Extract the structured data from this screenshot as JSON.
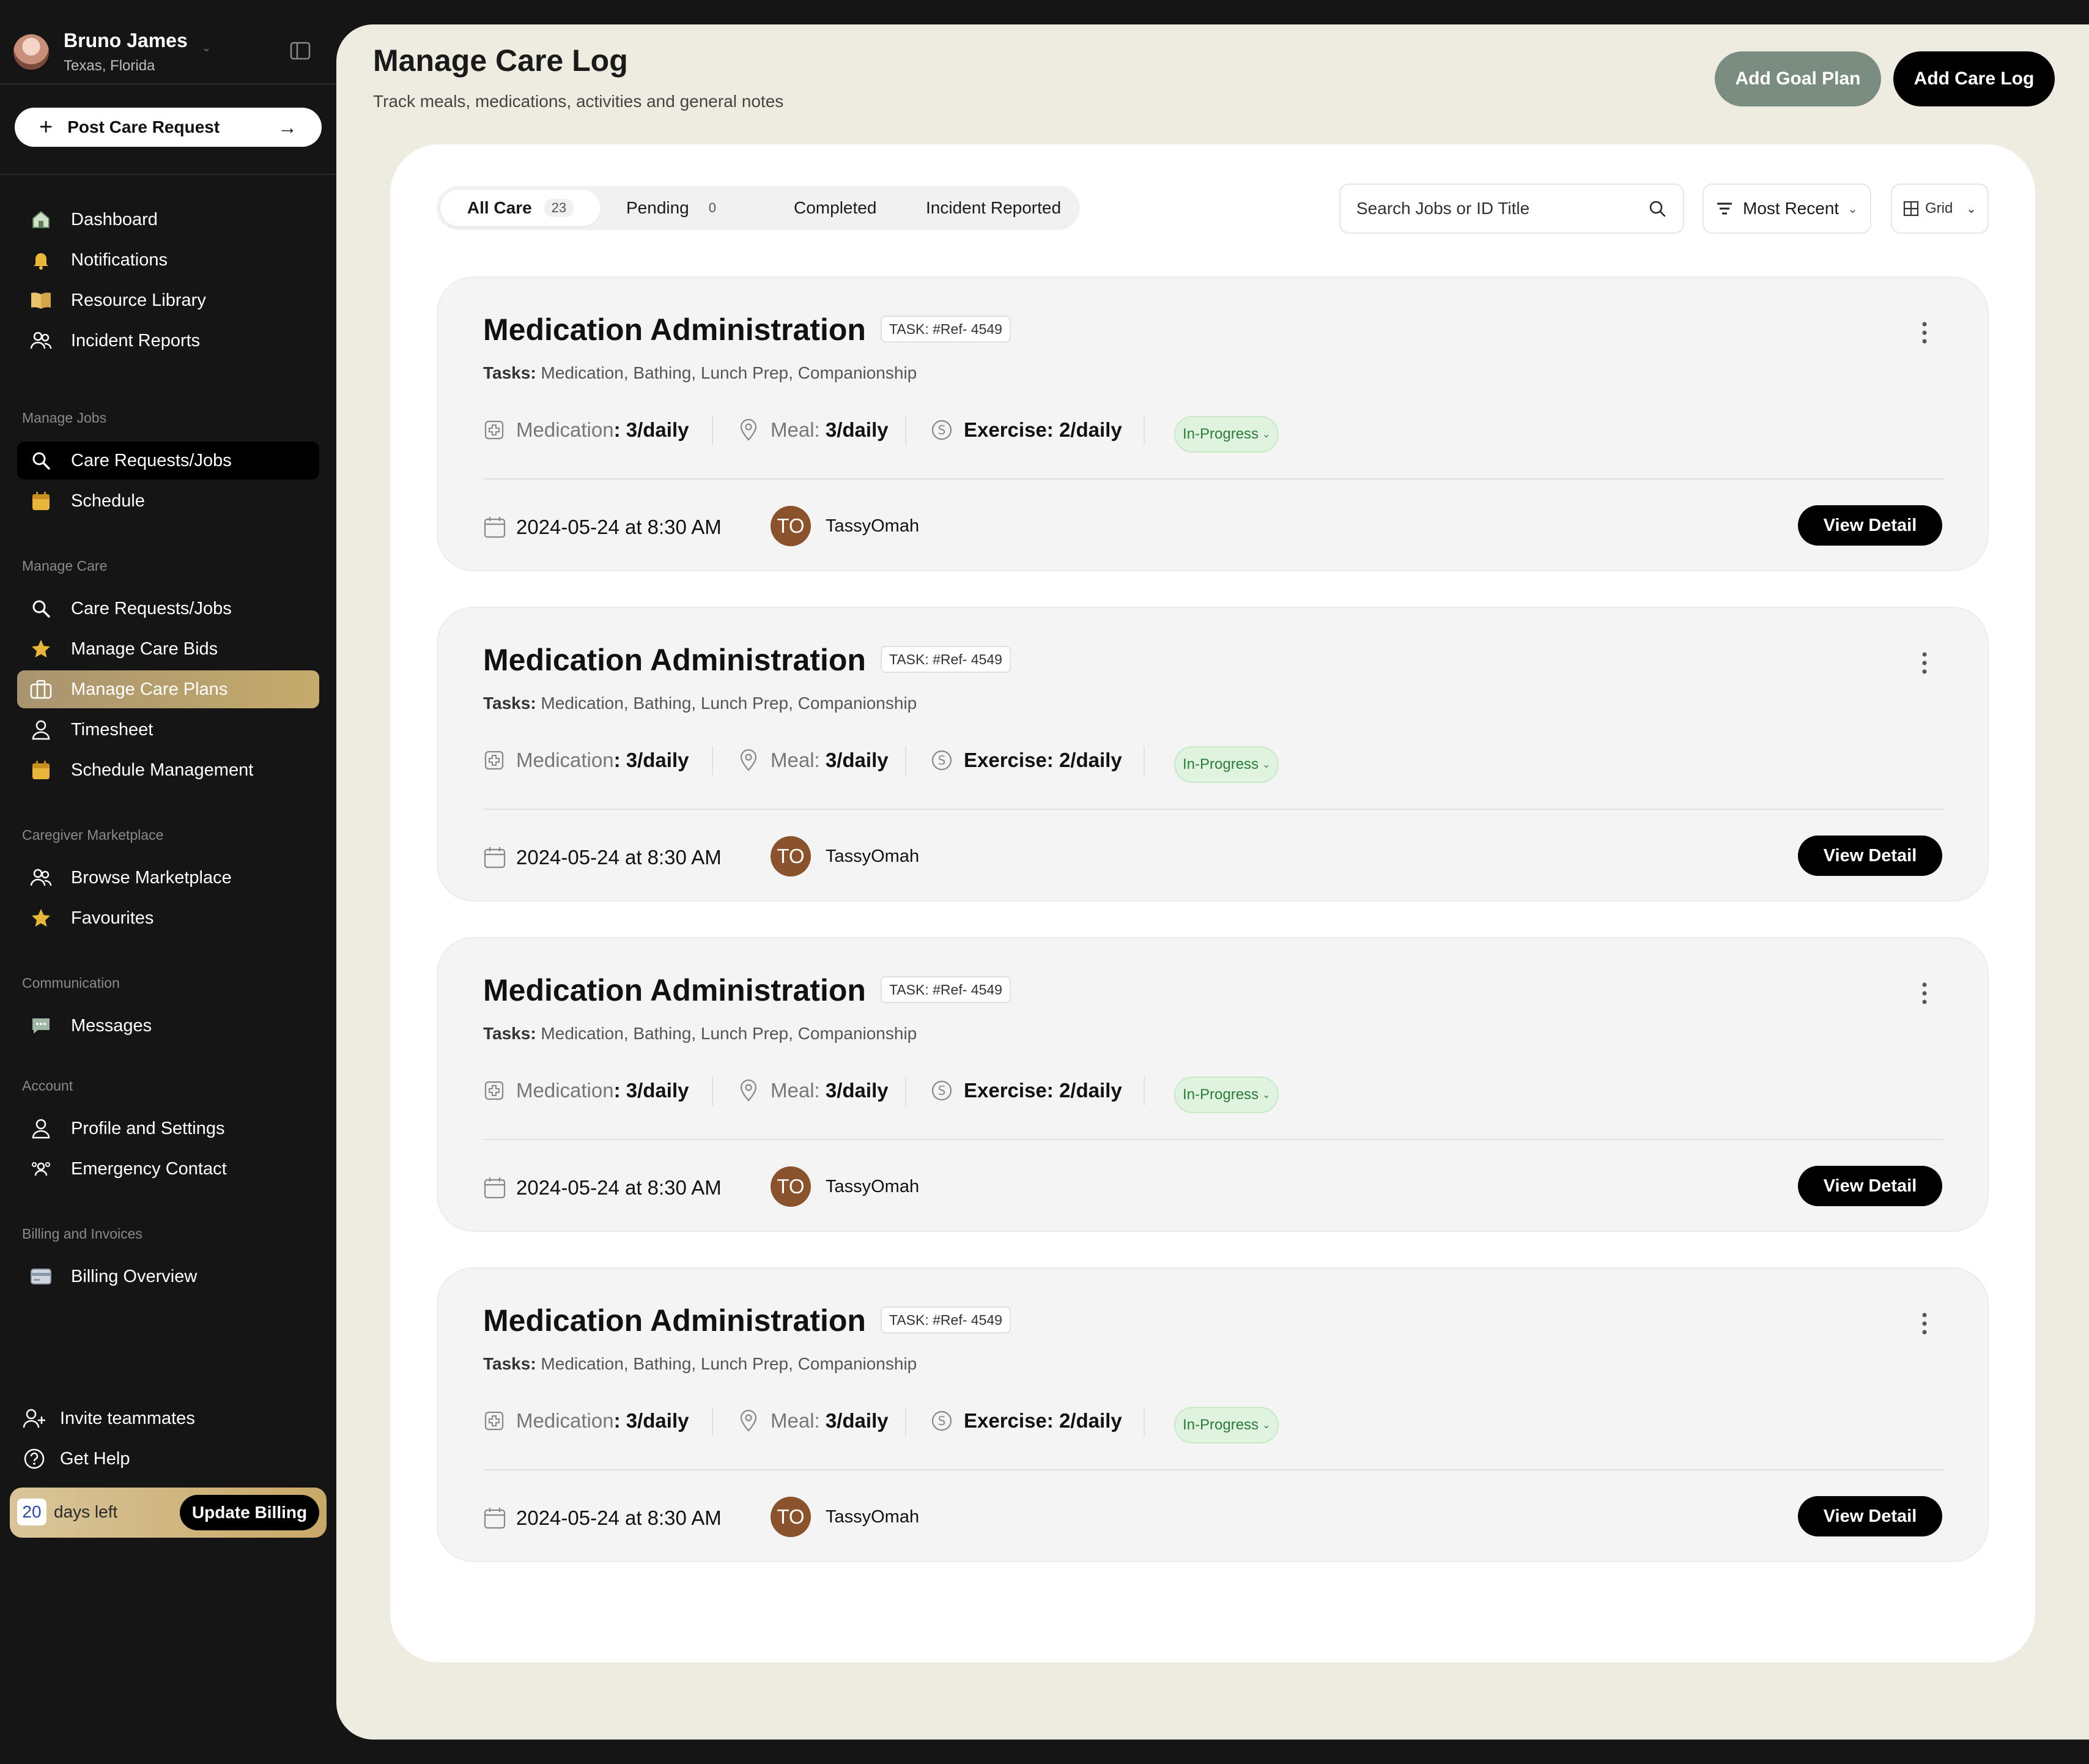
{
  "user": {
    "name": "Bruno James",
    "location": "Texas, Florida"
  },
  "post_request": {
    "label": "Post Care Request"
  },
  "nav_top": [
    {
      "label": "Dashboard",
      "icon": "home-icon"
    },
    {
      "label": "Notifications",
      "icon": "bell-icon"
    },
    {
      "label": "Resource Library",
      "icon": "book-icon"
    },
    {
      "label": "Incident Reports",
      "icon": "users-icon"
    }
  ],
  "sections": {
    "manage_jobs": "Manage Jobs",
    "manage_care": "Manage Care",
    "marketplace": "Caregiver Marketplace",
    "communication": "Communication",
    "account": "Account",
    "billing": "Billing and Invoices"
  },
  "nav_manage_jobs": [
    {
      "label": "Care Requests/Jobs",
      "icon": "search-icon",
      "active": true
    },
    {
      "label": "Schedule",
      "icon": "calendar-icon"
    }
  ],
  "nav_manage_care": [
    {
      "label": "Care Requests/Jobs",
      "icon": "search-icon"
    },
    {
      "label": "Manage Care Bids",
      "icon": "star-icon"
    },
    {
      "label": "Manage Care Plans",
      "icon": "briefcase-icon",
      "active": true
    },
    {
      "label": "Timesheet",
      "icon": "user-icon"
    },
    {
      "label": "Schedule Management",
      "icon": "calendar-icon"
    }
  ],
  "nav_marketplace": [
    {
      "label": "Browse Marketplace",
      "icon": "users-icon"
    },
    {
      "label": "Favourites",
      "icon": "star-icon"
    }
  ],
  "nav_communication": [
    {
      "label": "Messages",
      "icon": "chat-icon"
    }
  ],
  "nav_account": [
    {
      "label": "Profile and Settings",
      "icon": "user-icon"
    },
    {
      "label": "Emergency Contact",
      "icon": "contact-icon"
    }
  ],
  "nav_billing": [
    {
      "label": "Billing Overview",
      "icon": "card-icon"
    }
  ],
  "bottom": {
    "invite": "Invite teammates",
    "help": "Get Help"
  },
  "billing": {
    "days": "20",
    "days_text": "days left",
    "update_label": "Update Billing"
  },
  "header": {
    "title": "Manage Care Log",
    "subtitle": "Track meals, medications, activities and general notes",
    "goal_plan_label": "Add Goal Plan",
    "care_log_label": "Add Care Log"
  },
  "tabs": [
    {
      "label": "All Care",
      "count": "23",
      "active": true
    },
    {
      "label": "Pending",
      "count": "0"
    },
    {
      "label": "Completed"
    },
    {
      "label": "Incident Reported"
    }
  ],
  "search": {
    "placeholder": "Search Jobs or ID Title"
  },
  "sort": {
    "label": "Most Recent"
  },
  "view_toggle": {
    "label": "Grid"
  },
  "colors": {
    "accent_gold": "#c5ab6c",
    "goal_button": "#7b8c80",
    "status_green": "#2b7a3b",
    "avatar_brown": "#8b532d"
  },
  "cards": [
    {
      "title": "Medication Administration",
      "task_id": "TASK: #Ref- 4549",
      "tasks_label": "Tasks:",
      "tasks": "Medication, Bathing, Lunch Prep, Companionship",
      "medication_label": "Medication",
      "medication": ": 3/daily",
      "meal_label": "Meal:",
      "meal": "3/daily",
      "exercise_label": "Exercise:",
      "exercise": "2/daily",
      "status": "In-Progress",
      "datetime": "2024-05-24 at 8:30 AM",
      "assignee_initials": "TO",
      "assignee": "TassyOmah",
      "view_label": "View Detail"
    },
    {
      "title": "Medication Administration",
      "task_id": "TASK: #Ref- 4549",
      "tasks_label": "Tasks:",
      "tasks": "Medication, Bathing, Lunch Prep, Companionship",
      "medication_label": "Medication",
      "medication": ": 3/daily",
      "meal_label": "Meal:",
      "meal": "3/daily",
      "exercise_label": "Exercise:",
      "exercise": "2/daily",
      "status": "In-Progress",
      "datetime": "2024-05-24 at 8:30 AM",
      "assignee_initials": "TO",
      "assignee": "TassyOmah",
      "view_label": "View Detail"
    },
    {
      "title": "Medication Administration",
      "task_id": "TASK: #Ref- 4549",
      "tasks_label": "Tasks:",
      "tasks": "Medication, Bathing, Lunch Prep, Companionship",
      "medication_label": "Medication",
      "medication": ": 3/daily",
      "meal_label": "Meal:",
      "meal": "3/daily",
      "exercise_label": "Exercise:",
      "exercise": "2/daily",
      "status": "In-Progress",
      "datetime": "2024-05-24 at 8:30 AM",
      "assignee_initials": "TO",
      "assignee": "TassyOmah",
      "view_label": "View Detail"
    },
    {
      "title": "Medication Administration",
      "task_id": "TASK: #Ref- 4549",
      "tasks_label": "Tasks:",
      "tasks": "Medication, Bathing, Lunch Prep, Companionship",
      "medication_label": "Medication",
      "medication": ": 3/daily",
      "meal_label": "Meal:",
      "meal": "3/daily",
      "exercise_label": "Exercise:",
      "exercise": "2/daily",
      "status": "In-Progress",
      "datetime": "2024-05-24 at 8:30 AM",
      "assignee_initials": "TO",
      "assignee": "TassyOmah",
      "view_label": "View Detail"
    }
  ]
}
